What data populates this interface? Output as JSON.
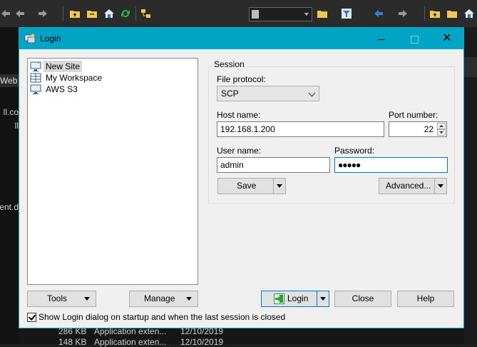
{
  "background": {
    "left_snippets": [
      "Web",
      "ll.co",
      "ll",
      "ent.d"
    ],
    "bottom_rows": [
      {
        "size": "286 KB",
        "type": "Application exten...",
        "date": "12/10/2019"
      },
      {
        "size": "148 KB",
        "type": "Application exten...",
        "date": "12/10/2019"
      }
    ]
  },
  "dialog": {
    "title": "Login",
    "window_controls": {
      "minimize": "—",
      "maximize": "☐",
      "close": "✕"
    },
    "sites": [
      {
        "label": "New Site",
        "icon": "new-site-monitor-icon",
        "selected": true
      },
      {
        "label": "My Workspace",
        "icon": "workspace-icon",
        "selected": false
      },
      {
        "label": "AWS S3",
        "icon": "monitor-icon",
        "selected": false
      }
    ],
    "tools_label": "Tools",
    "manage_label": "Manage",
    "session": {
      "group_title": "Session",
      "file_protocol_label": "File protocol:",
      "file_protocol_value": "SCP",
      "host_label": "Host name:",
      "host_value": "192.168.1.200",
      "port_label": "Port number:",
      "port_value": "22",
      "user_label": "User name:",
      "user_value": "admin",
      "password_label": "Password:",
      "password_value": "●●●●●",
      "save_label": "Save",
      "advanced_label": "Advanced..."
    },
    "login_label": "Login",
    "close_label": "Close",
    "help_label": "Help",
    "startup_checkbox_label": "Show Login dialog on startup and when the last session is closed",
    "startup_checked": true
  },
  "colors": {
    "titlebar": "#00a4c4",
    "focus": "#0078d7",
    "login_icon": "#2e9e3e"
  }
}
